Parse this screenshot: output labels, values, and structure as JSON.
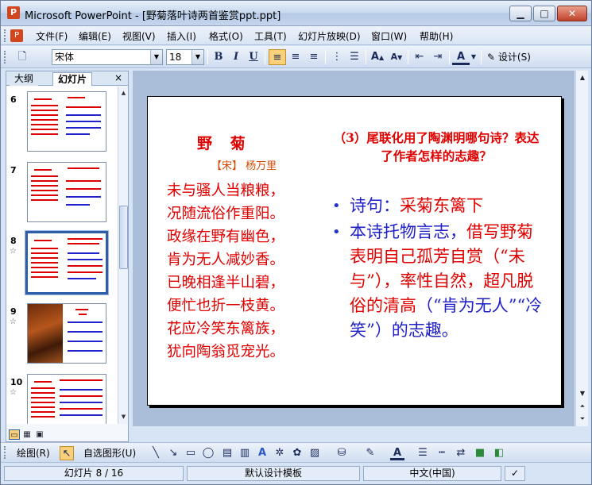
{
  "window": {
    "title": "Microsoft PowerPoint - [野菊落叶诗两首鉴赏ppt.ppt]",
    "app_icon": "P",
    "minimize": "▁",
    "maximize": "□",
    "close": "✕"
  },
  "menu": {
    "items": [
      "文件(F)",
      "编辑(E)",
      "视图(V)",
      "插入(I)",
      "格式(O)",
      "工具(T)",
      "幻灯片放映(D)",
      "窗口(W)",
      "帮助(H)"
    ]
  },
  "toolbar": {
    "font_name": "宋体",
    "font_size": "18",
    "bold": "B",
    "italic": "I",
    "underline": "U",
    "design_label": "设计(S)",
    "font_color_label": "A"
  },
  "left_pane": {
    "tab_outline": "大纲",
    "tab_slides": "幻灯片",
    "close": "×",
    "slides": [
      {
        "number": "6",
        "selected": false,
        "star": false
      },
      {
        "number": "7",
        "selected": false,
        "star": false
      },
      {
        "number": "8",
        "selected": true,
        "star": true
      },
      {
        "number": "9",
        "selected": false,
        "star": true
      },
      {
        "number": "10",
        "selected": false,
        "star": true
      }
    ]
  },
  "slide": {
    "poem_title": "野 菊",
    "poem_author": "【宋】 杨万里",
    "poem_lines": [
      "未与骚人当粮粮，",
      "况随流俗作重阳。",
      "政缘在野有幽色，",
      "肯为无人减妙香。",
      "已晚相逢半山碧，",
      "便忙也折一枝黄。",
      "花应冷笑东篱族，",
      "犹向陶翁觅宠光。"
    ],
    "question": "（3）尾联化用了陶渊明哪句诗？表达了作者怎样的志趣？",
    "bullet1_label": "诗句：",
    "bullet1_value": "采菊东篱下",
    "bullet2_parts": [
      {
        "text": "本诗托物言志，",
        "color": "blue"
      },
      {
        "text": "借写野菊表明自己孤芳自赏（“未与”），率性自然，超凡脱俗的清高",
        "color": "red"
      },
      {
        "text": "（“肯为无人”“冷笑”）的志趣。",
        "color": "blue"
      }
    ]
  },
  "drawbar": {
    "draw_label": "绘图(R)",
    "autoshapes_label": "自选图形(U)"
  },
  "status": {
    "slide_info": "幻灯片 8 / 16",
    "template": "默认设计模板",
    "language": "中文(中国)"
  },
  "colors": {
    "red_text": "#e00000",
    "blue_text": "#1f1fc7",
    "selected_border": "#2f5ea8"
  }
}
